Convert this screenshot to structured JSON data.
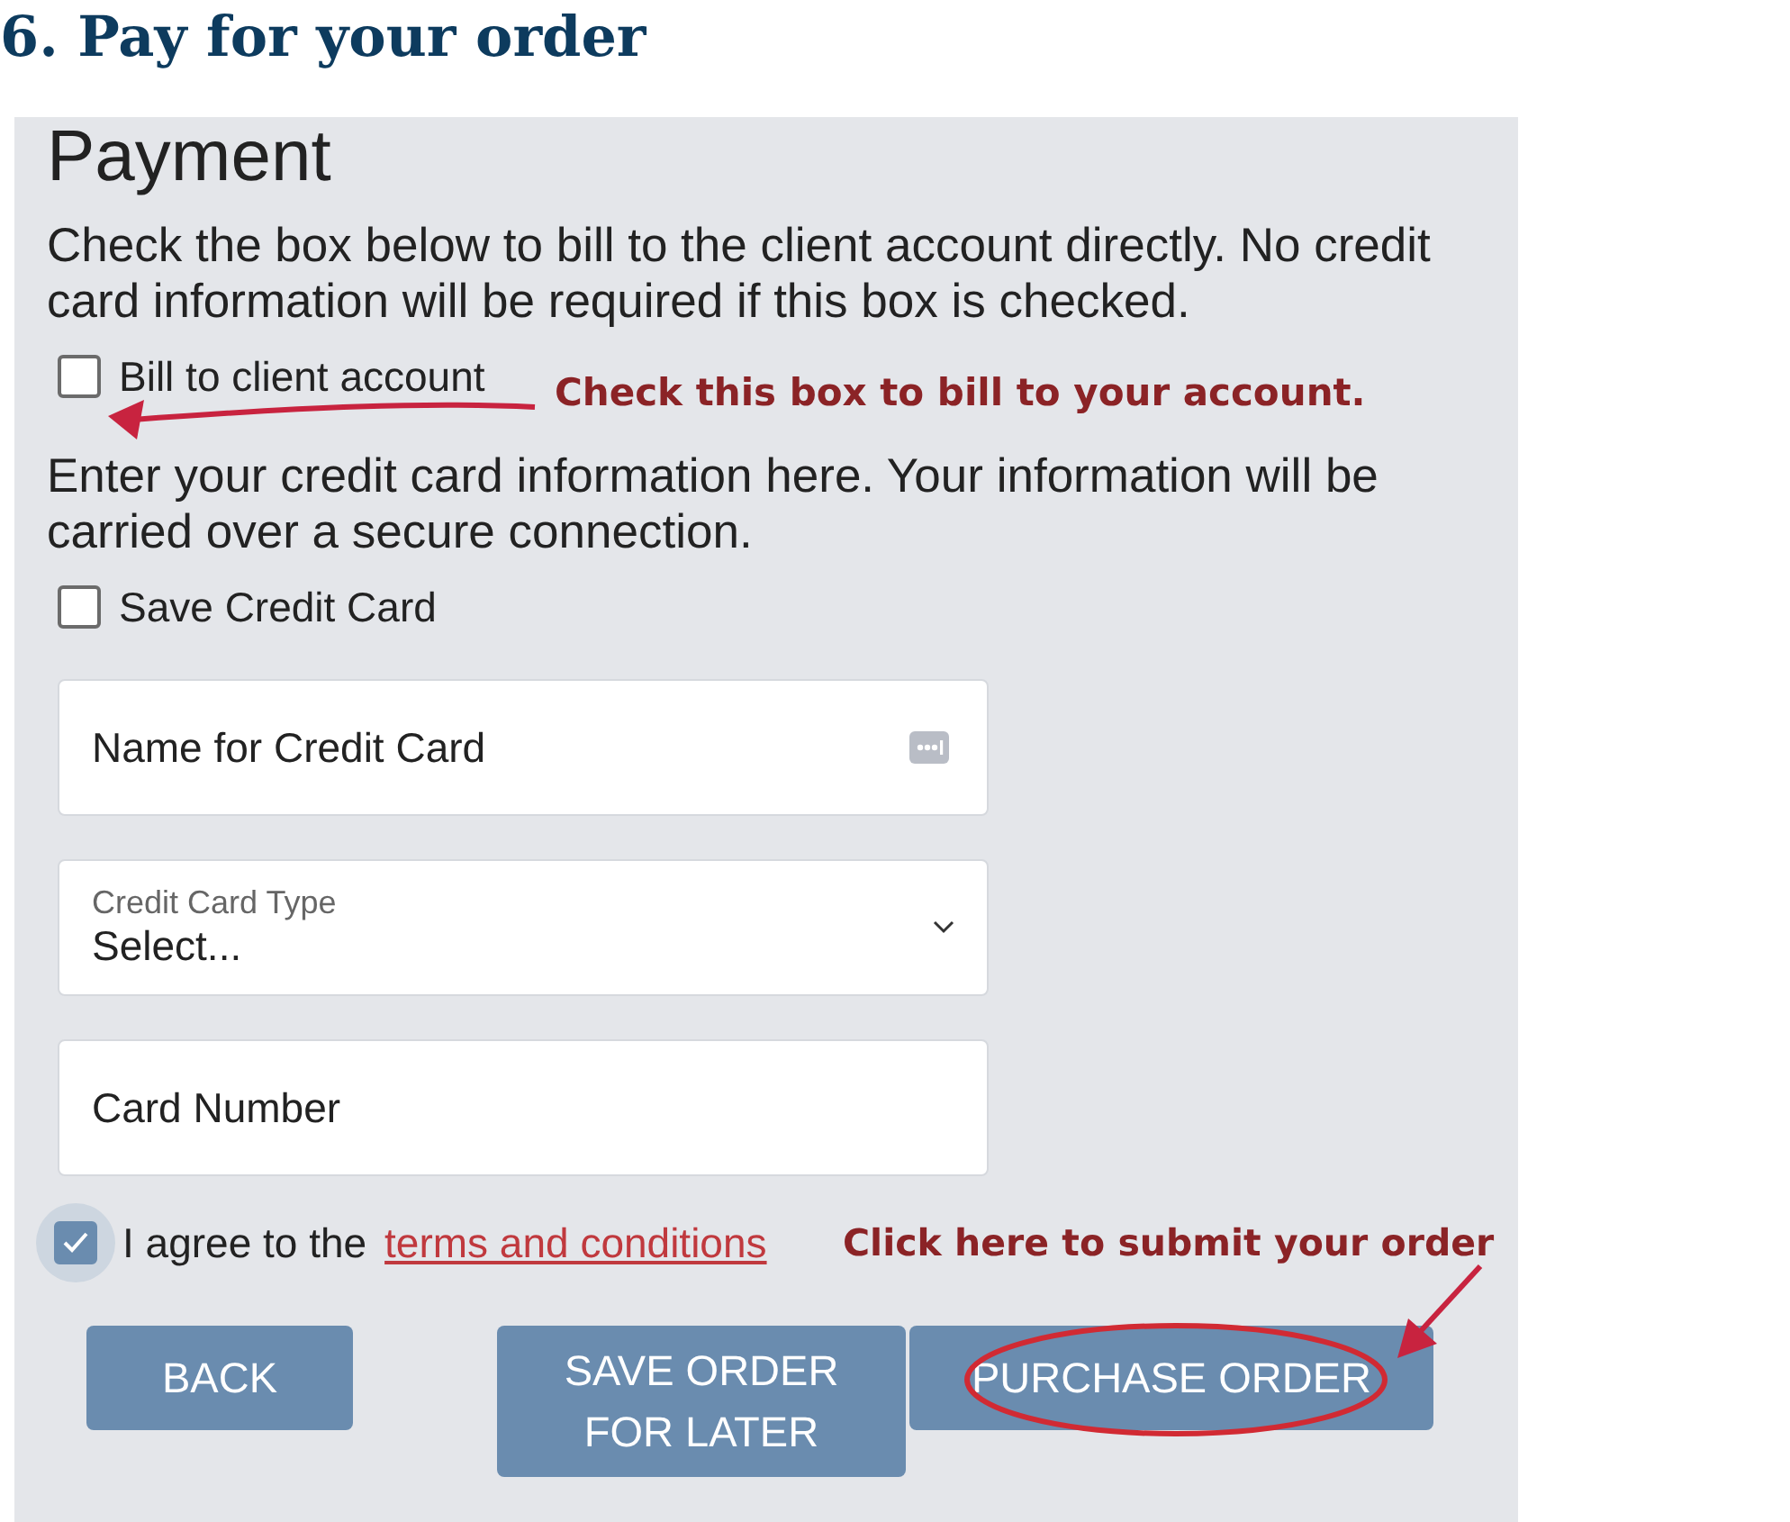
{
  "heading": "6. Pay for your order",
  "payment": {
    "title": "Payment",
    "intro": "Check the box below to bill to the client account directly. No credit card information will be required if this box is checked.",
    "bill_to_account": {
      "label": "Bill to client account",
      "checked": false
    },
    "card_intro": "Enter your credit card information here. Your information will be carried over a secure connection.",
    "save_card": {
      "label": "Save Credit Card",
      "checked": false
    },
    "fields": [
      {
        "kind": "text",
        "placeholder": "Name for Credit Card"
      },
      {
        "kind": "select",
        "label": "Credit Card Type",
        "value": "Select..."
      },
      {
        "kind": "text",
        "placeholder": "Card Number"
      }
    ],
    "agree": {
      "checked": true,
      "text": "I agree to the",
      "link": "terms and conditions"
    },
    "buttons": [
      "BACK",
      "SAVE ORDER FOR LATER",
      "PURCHASE ORDER"
    ]
  },
  "annotations": [
    {
      "text": "Check this box to bill to your account."
    },
    {
      "text": "Click here to submit your order"
    }
  ]
}
